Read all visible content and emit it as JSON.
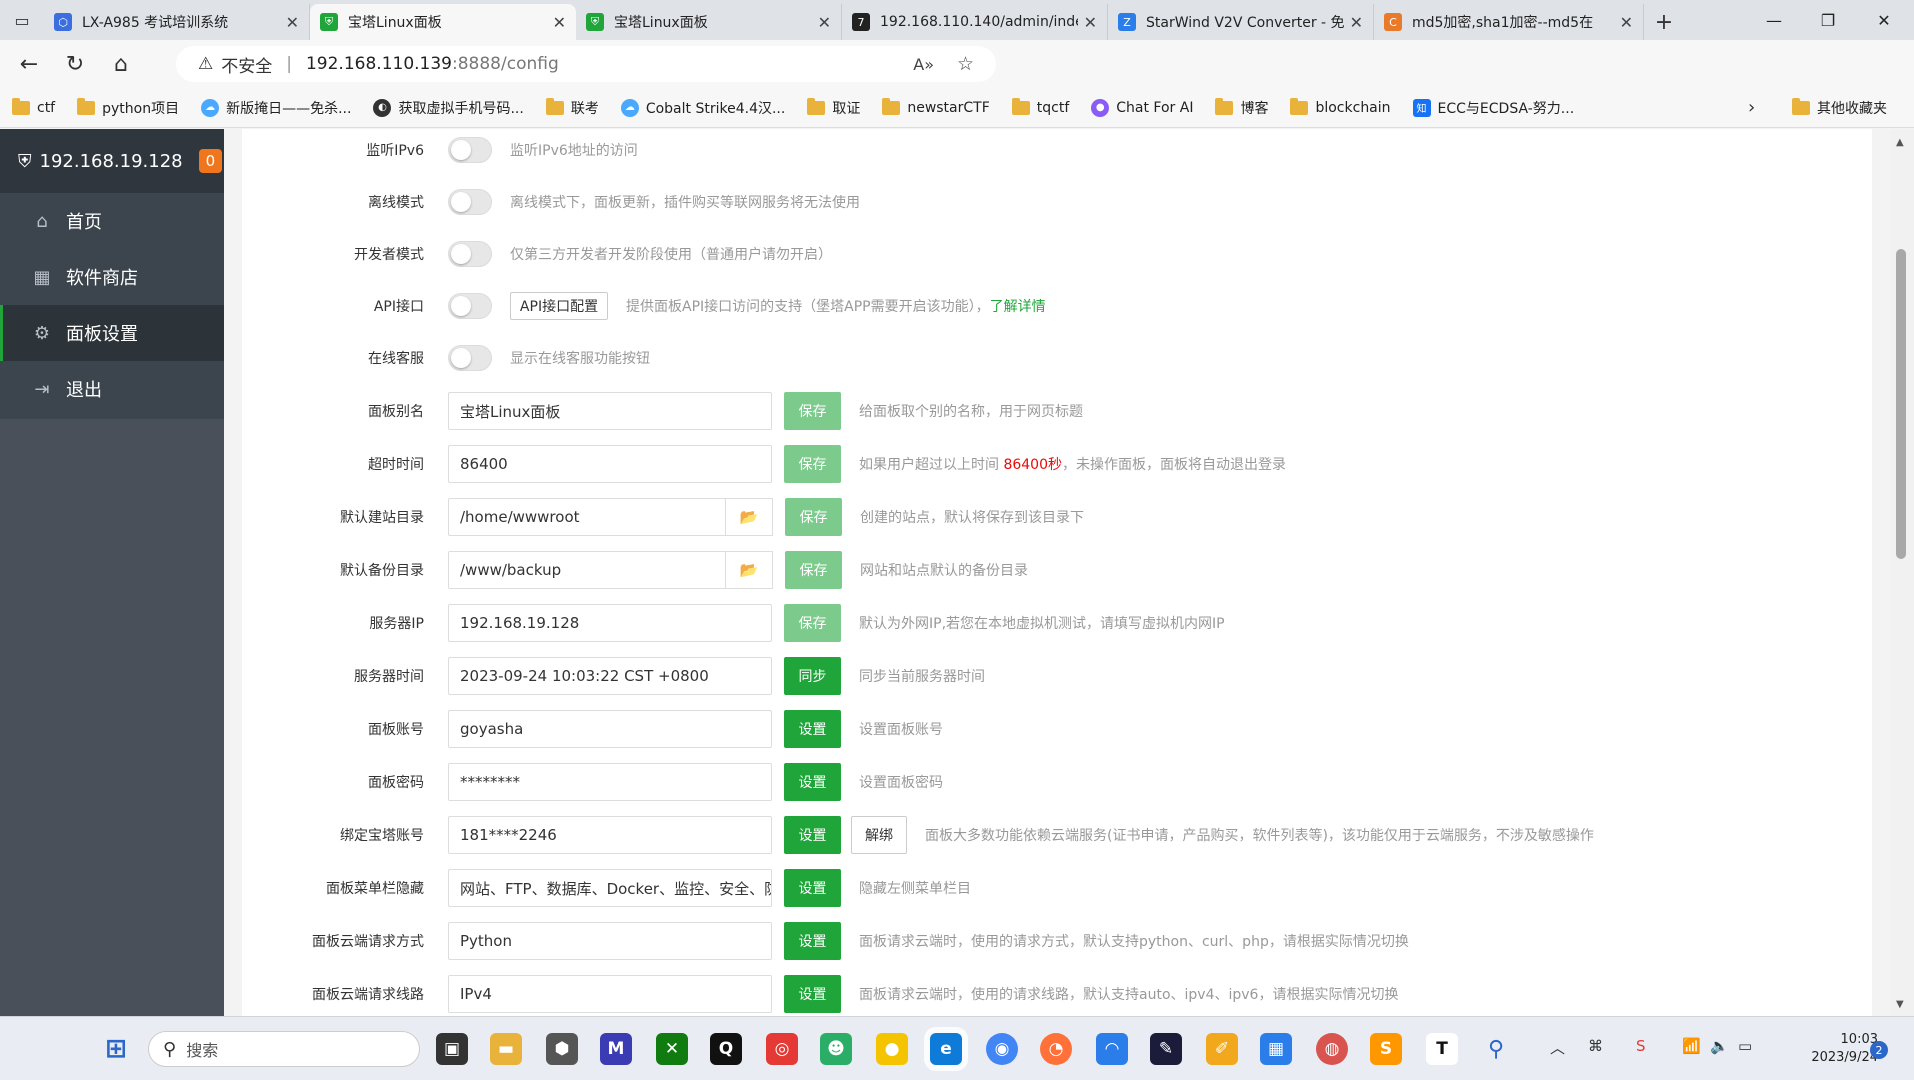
{
  "browser": {
    "tabs": [
      {
        "title": "LX-A985 考试培训系统",
        "active": false,
        "favicon_color": "#3b6fe0"
      },
      {
        "title": "宝塔Linux面板",
        "active": true,
        "favicon_color": "#20a53a"
      },
      {
        "title": "宝塔Linux面板",
        "active": false,
        "favicon_color": "#20a53a"
      },
      {
        "title": "192.168.110.140/admin/inde",
        "active": false,
        "favicon_color": "#222222"
      },
      {
        "title": "StarWind V2V Converter - 免",
        "active": false,
        "favicon_color": "#2b7de9"
      },
      {
        "title": "md5加密,sha1加密--md5在",
        "active": false,
        "favicon_color": "#e87a2a"
      }
    ],
    "address": {
      "security_label": "不安全",
      "host": "192.168.110.139",
      "path": ":8888/config"
    },
    "bookmarks": [
      {
        "label": "ctf",
        "type": "folder"
      },
      {
        "label": "python项目",
        "type": "folder"
      },
      {
        "label": "新版掩日——免杀...",
        "type": "site"
      },
      {
        "label": "获取虚拟手机号码...",
        "type": "site"
      },
      {
        "label": "联考",
        "type": "folder"
      },
      {
        "label": "Cobalt Strike4.4汉...",
        "type": "site"
      },
      {
        "label": "取证",
        "type": "folder"
      },
      {
        "label": "newstarCTF",
        "type": "folder"
      },
      {
        "label": "tqctf",
        "type": "folder"
      },
      {
        "label": "Chat For AI",
        "type": "site"
      },
      {
        "label": "博客",
        "type": "folder"
      },
      {
        "label": "blockchain",
        "type": "folder"
      },
      {
        "label": "ECC与ECDSA-努力...",
        "type": "site"
      }
    ],
    "other_bookmarks": "其他收藏夹"
  },
  "sidebar": {
    "server_ip": "192.168.19.128",
    "badge": "0",
    "items": [
      {
        "label": "首页",
        "icon": "home-icon",
        "glyph": "⌂",
        "active": false
      },
      {
        "label": "软件商店",
        "icon": "grid-icon",
        "glyph": "▦",
        "active": false
      },
      {
        "label": "面板设置",
        "icon": "gear-icon",
        "glyph": "⚙",
        "active": true
      },
      {
        "label": "退出",
        "icon": "logout-icon",
        "glyph": "⇥",
        "active": false
      }
    ]
  },
  "settings": {
    "ipv6": {
      "label": "监听IPv6",
      "hint": "监听IPv6地址的访问"
    },
    "offline": {
      "label": "离线模式",
      "hint": "离线模式下，面板更新，插件购买等联网服务将无法使用"
    },
    "developer": {
      "label": "开发者模式",
      "hint": "仅第三方开发者开发阶段使用（普通用户请勿开启）"
    },
    "api": {
      "label": "API接口",
      "button": "API接口配置",
      "hint": "提供面板API接口访问的支持（堡塔APP需要开启该功能），",
      "link": "了解详情"
    },
    "support": {
      "label": "在线客服",
      "hint": "显示在线客服功能按钮"
    },
    "alias": {
      "label": "面板别名",
      "value": "宝塔Linux面板",
      "button": "保存",
      "hint": "给面板取个别的名称，用于网页标题"
    },
    "timeout": {
      "label": "超时时间",
      "value": "86400",
      "button": "保存",
      "hint_pre": "如果用户超过以上时间 ",
      "hint_red": "86400秒",
      "hint_post": "，未操作面板，面板将自动退出登录"
    },
    "site_dir": {
      "label": "默认建站目录",
      "value": "/home/wwwroot",
      "button": "保存",
      "hint": "创建的站点，默认将保存到该目录下"
    },
    "backup_dir": {
      "label": "默认备份目录",
      "value": "/www/backup",
      "button": "保存",
      "hint": "网站和站点默认的备份目录"
    },
    "server_ip": {
      "label": "服务器IP",
      "value": "192.168.19.128",
      "button": "保存",
      "hint": "默认为外网IP,若您在本地虚拟机测试，请填写虚拟机内网IP"
    },
    "server_time": {
      "label": "服务器时间",
      "value": "2023-09-24 10:03:22 CST +0800",
      "button": "同步",
      "hint": "同步当前服务器时间"
    },
    "account": {
      "label": "面板账号",
      "value": "goyasha",
      "button": "设置",
      "hint": "设置面板账号"
    },
    "password": {
      "label": "面板密码",
      "value": "********",
      "button": "设置",
      "hint": "设置面板密码"
    },
    "bt_account": {
      "label": "绑定宝塔账号",
      "value": "181****2246",
      "button": "设置",
      "unbind": "解绑",
      "hint": "面板大多数功能依赖云端服务(证书申请，产品购买，软件列表等)，该功能仅用于云端服务，不涉及敏感操作"
    },
    "menu_hide": {
      "label": "面板菜单栏隐藏",
      "value": "网站、FTP、数据库、Docker、监控、安全、防",
      "button": "设置",
      "hint": "隐藏左侧菜单栏目"
    },
    "cloud_method": {
      "label": "面板云端请求方式",
      "value": "Python",
      "button": "设置",
      "hint": "面板请求云端时，使用的请求方式，默认支持python、curl、php，请根据实际情况切换"
    },
    "cloud_line": {
      "label": "面板云端请求线路",
      "value": "IPv4",
      "button": "设置",
      "hint": "面板请求云端时，使用的请求线路，默认支持auto、ipv4、ipv6，请根据实际情况切换"
    }
  },
  "taskbar": {
    "search_placeholder": "搜索",
    "time": "10:03",
    "date": "2023/9/24",
    "notifications": "2"
  }
}
